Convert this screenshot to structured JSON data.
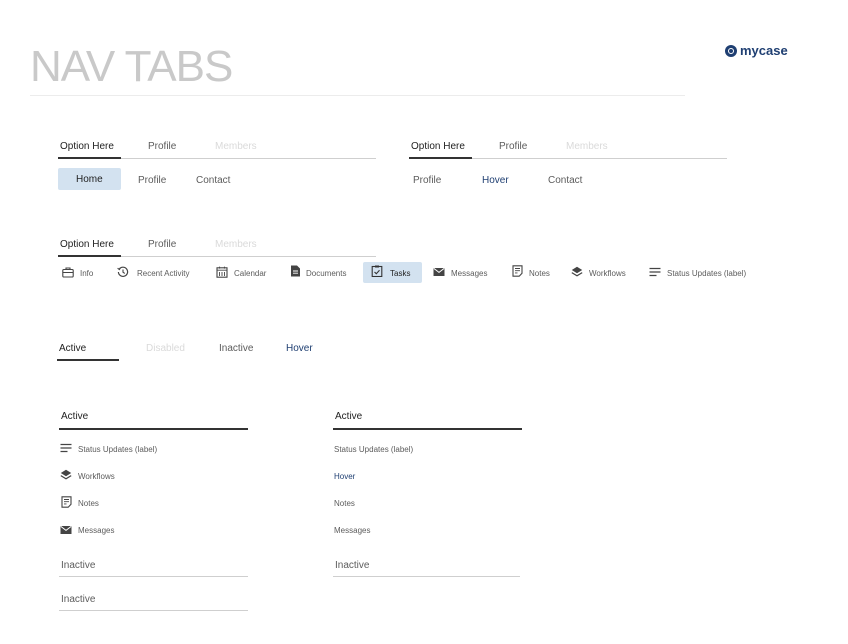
{
  "header": {
    "title": "NAV TABS",
    "logo_text": "mycase",
    "brand_color": "#1f3f72"
  },
  "set_a": {
    "tab1": "Option Here",
    "tab2": "Profile",
    "tab3": "Members"
  },
  "set_b": {
    "tab1": "Option Here",
    "tab2": "Profile",
    "tab3": "Members"
  },
  "pill_row": {
    "home": "Home",
    "profile": "Profile",
    "contact": "Contact"
  },
  "hover_row": {
    "profile": "Profile",
    "hover": "Hover",
    "contact": "Contact"
  },
  "set_c": {
    "tab1": "Option Here",
    "tab2": "Profile",
    "tab3": "Members"
  },
  "icon_tabs": [
    {
      "label": "Info",
      "icon": "briefcase-icon"
    },
    {
      "label": "Recent Activity",
      "icon": "history-icon"
    },
    {
      "label": "Calendar",
      "icon": "calendar-icon"
    },
    {
      "label": "Documents",
      "icon": "document-icon"
    },
    {
      "label": "Tasks",
      "icon": "clipboard-icon"
    },
    {
      "label": "Messages",
      "icon": "envelope-icon"
    },
    {
      "label": "Notes",
      "icon": "notes-icon"
    },
    {
      "label": "Workflows",
      "icon": "layers-icon"
    },
    {
      "label": "Status Updates (label)",
      "icon": "lines-icon"
    }
  ],
  "states": {
    "active": "Active",
    "disabled": "Disabled",
    "inactive": "Inactive",
    "hover": "Hover"
  },
  "vert_left": {
    "active": "Active",
    "items": [
      "Status Updates (label)",
      "Workflows",
      "Notes",
      "Messages"
    ],
    "inactive1": "Inactive",
    "inactive2": "Inactive"
  },
  "vert_right": {
    "active": "Active",
    "items": [
      "Status Updates (label)",
      "Hover",
      "Notes",
      "Messages"
    ],
    "inactive1": "Inactive"
  }
}
